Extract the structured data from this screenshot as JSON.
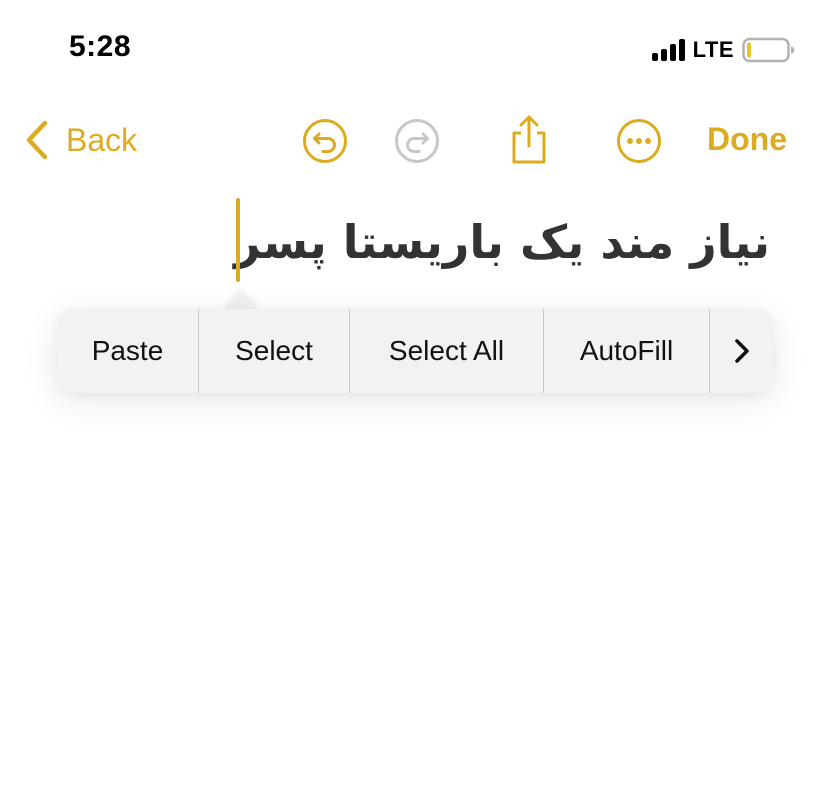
{
  "status_bar": {
    "time": "5:28",
    "network": "LTE",
    "signal_bars": 4,
    "battery_level_percent": 10
  },
  "nav": {
    "back_label": "Back",
    "done_label": "Done",
    "icons": [
      "chevron-left-icon",
      "undo-icon",
      "redo-icon",
      "share-icon",
      "more-icon"
    ]
  },
  "note": {
    "title": "نیاز مند یک باریستا پسر"
  },
  "edit_menu": {
    "items": [
      "Paste",
      "Select",
      "Select All",
      "AutoFill"
    ],
    "more_icon": "chevron-right-icon"
  },
  "colors": {
    "accent": "#dcab1f",
    "disabled_icon": "#c7c7c7",
    "title_text": "#333333",
    "menu_background": "#f2f2f2"
  }
}
